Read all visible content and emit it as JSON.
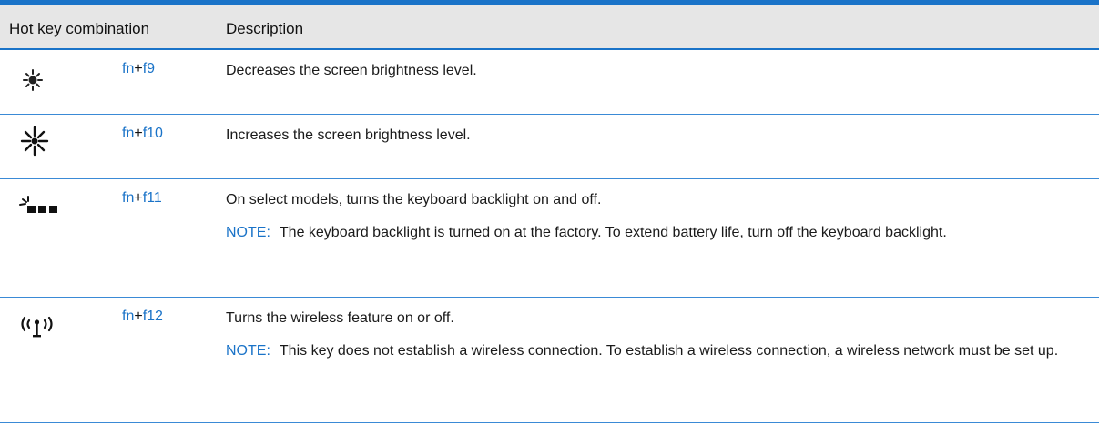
{
  "header": {
    "combo_label": "Hot key combination",
    "description_label": "Description"
  },
  "rows": [
    {
      "icon": "brightness-down-icon",
      "key_fn": "fn",
      "key_plus": "+",
      "key_f": "f9",
      "description": "Decreases the screen brightness level."
    },
    {
      "icon": "brightness-up-icon",
      "key_fn": "fn",
      "key_plus": "+",
      "key_f": "f10",
      "description": "Increases the screen brightness level."
    },
    {
      "icon": "keyboard-backlight-icon",
      "key_fn": "fn",
      "key_plus": "+",
      "key_f": "f11",
      "description": "On select models, turns the keyboard backlight on and off.",
      "note_label": "NOTE:",
      "note_text": "The keyboard backlight is turned on at the factory. To extend battery life, turn off the keyboard backlight."
    },
    {
      "icon": "wireless-icon",
      "key_fn": "fn",
      "key_plus": "+",
      "key_f": "f12",
      "description": "Turns the wireless feature on or off.",
      "note_label": "NOTE:",
      "note_text": "This key does not establish a wireless connection. To establish a wireless connection, a wireless network must be set up."
    }
  ],
  "colors": {
    "accent": "#1a73c8",
    "header_bg": "#e6e6e6",
    "text": "#1a1a1a"
  }
}
